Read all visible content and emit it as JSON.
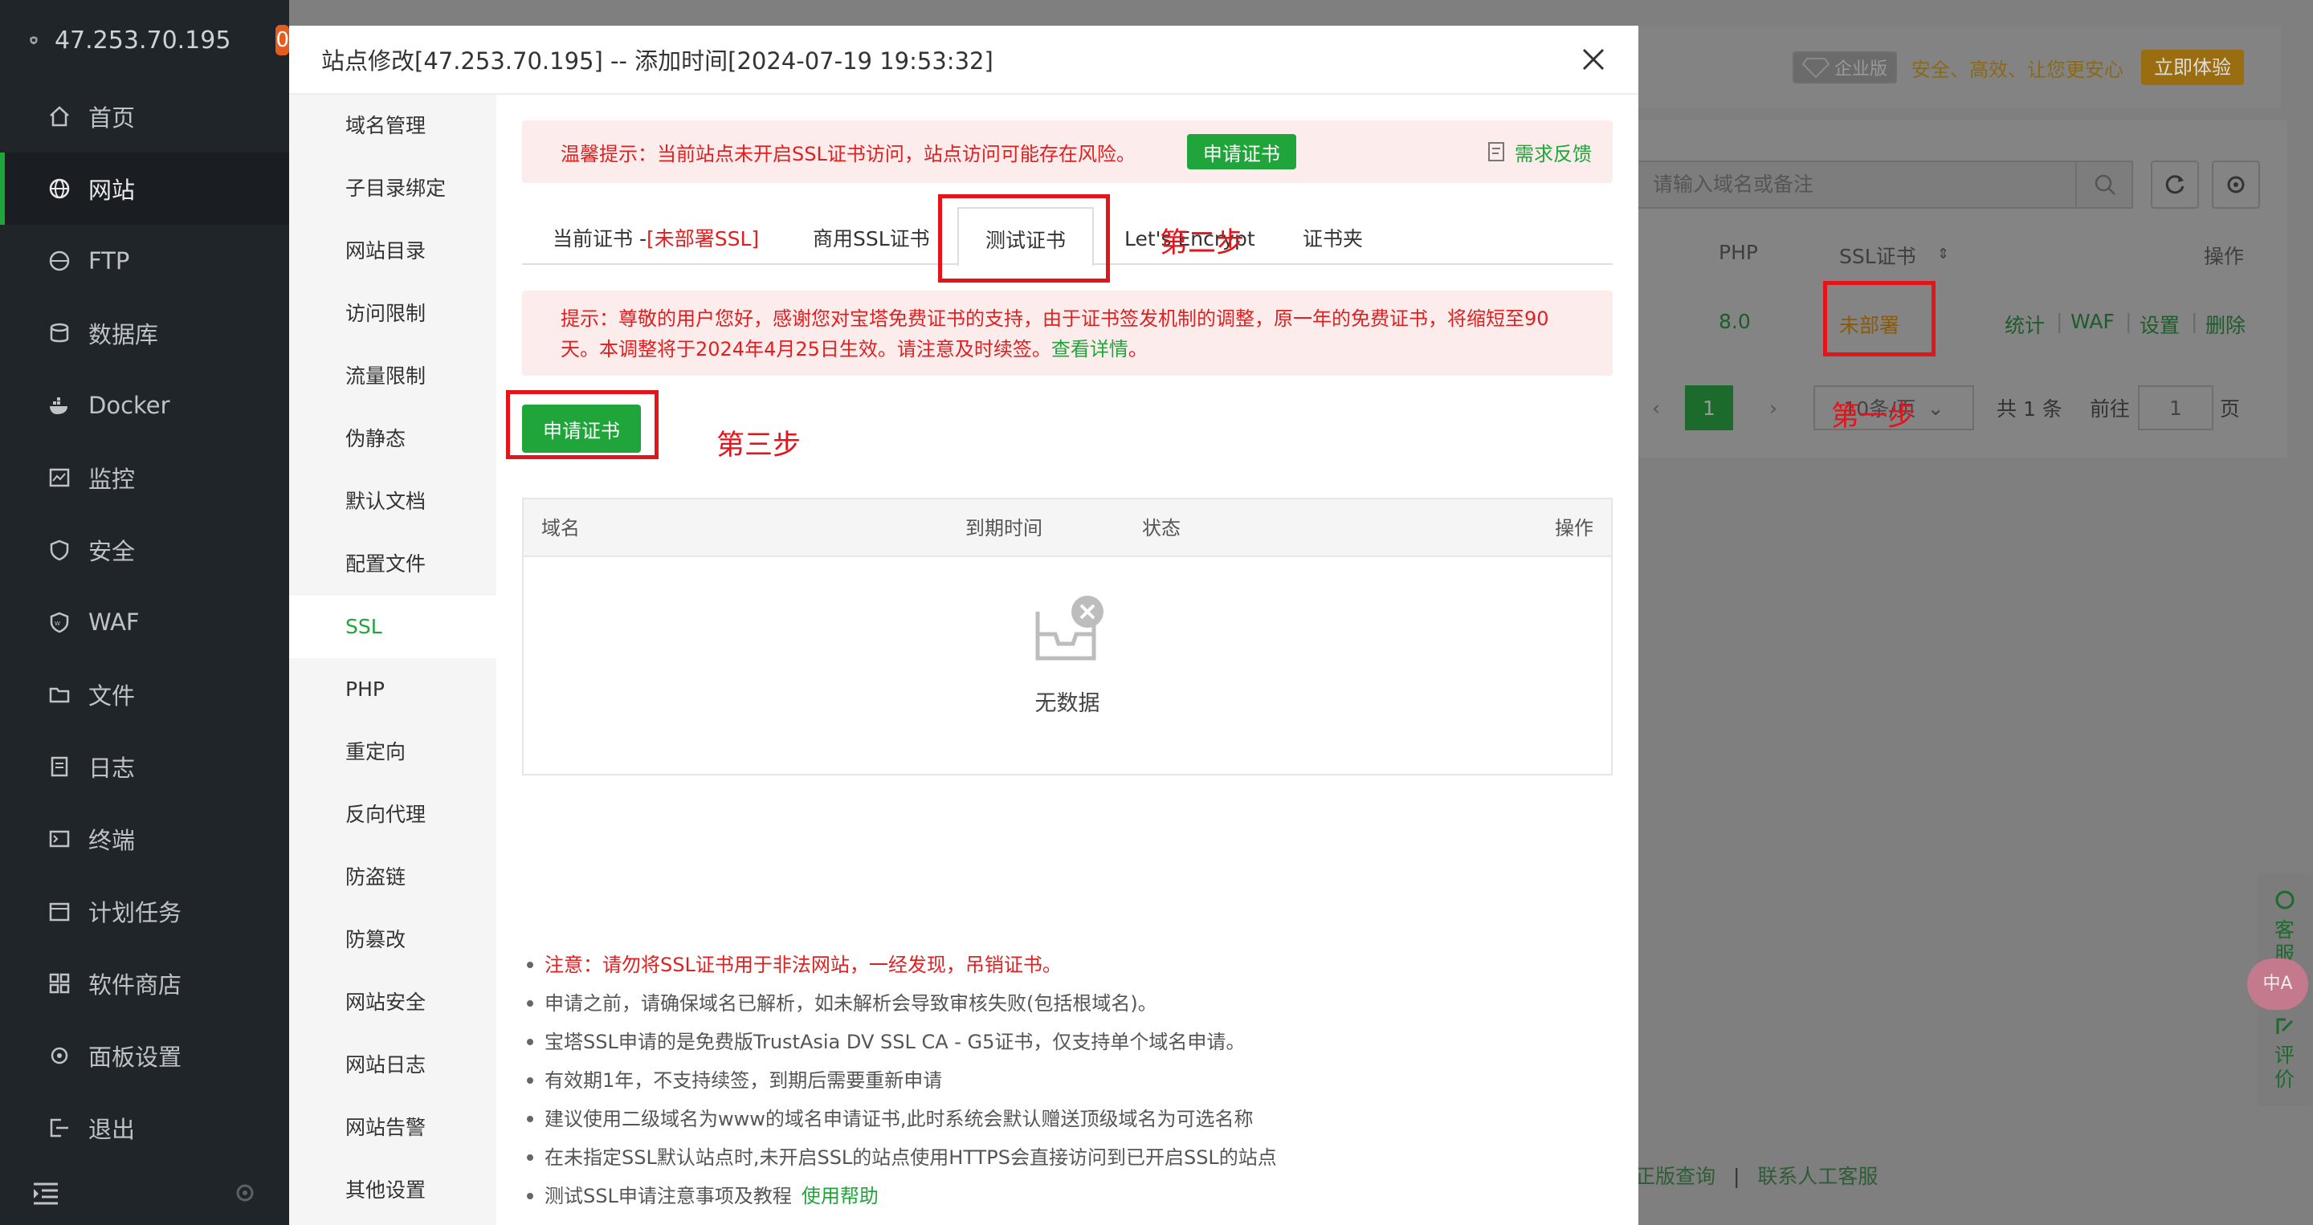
{
  "sidebar": {
    "ip": "47.253.70.195",
    "badge": "0",
    "items": [
      {
        "label": "首页",
        "icon": "home-icon"
      },
      {
        "label": "网站",
        "icon": "globe-icon"
      },
      {
        "label": "FTP",
        "icon": "ftp-icon"
      },
      {
        "label": "数据库",
        "icon": "database-icon"
      },
      {
        "label": "Docker",
        "icon": "docker-icon"
      },
      {
        "label": "监控",
        "icon": "monitor-icon"
      },
      {
        "label": "安全",
        "icon": "shield-icon"
      },
      {
        "label": "WAF",
        "icon": "waf-icon"
      },
      {
        "label": "文件",
        "icon": "folder-icon"
      },
      {
        "label": "日志",
        "icon": "log-icon"
      },
      {
        "label": "终端",
        "icon": "terminal-icon"
      },
      {
        "label": "计划任务",
        "icon": "calendar-icon"
      },
      {
        "label": "软件商店",
        "icon": "apps-icon"
      },
      {
        "label": "面板设置",
        "icon": "gear-icon"
      },
      {
        "label": "退出",
        "icon": "logout-icon"
      }
    ]
  },
  "background": {
    "enterprise": "企业版",
    "slogan": "安全、高效、让您更安心",
    "try_button": "立即体验",
    "search_placeholder": "请输入域名或备注",
    "columns": {
      "php": "PHP",
      "ssl": "SSL证书",
      "ops": "操作"
    },
    "row": {
      "php": "8.0",
      "ssl": "未部署",
      "actions": [
        "统计",
        "WAF",
        "设置",
        "删除"
      ]
    },
    "pagination": {
      "current": "1",
      "page_size": "10条/页",
      "total": "共 1 条",
      "goto_label": "前往",
      "goto_value": "1",
      "page_unit": "页"
    },
    "bottom_links": [
      "正版查询",
      "联系人工客服"
    ],
    "float": {
      "service": "客服",
      "review": "评价"
    }
  },
  "modal": {
    "title": "站点修改[47.253.70.195] -- 添加时间[2024-07-19 19:53:32]",
    "menu": [
      "域名管理",
      "子目录绑定",
      "网站目录",
      "访问限制",
      "流量限制",
      "伪静态",
      "默认文档",
      "配置文件",
      "SSL",
      "PHP",
      "重定向",
      "反向代理",
      "防盗链",
      "防篡改",
      "网站安全",
      "网站日志",
      "网站告警",
      "其他设置"
    ],
    "warning": {
      "text": "温馨提示：当前站点未开启SSL证书访问，站点访问可能存在风险。",
      "button": "申请证书",
      "feedback": "需求反馈"
    },
    "tabs": {
      "current_prefix": "当前证书 -",
      "current_status": "[未部署SSL]",
      "commercial": "商用SSL证书",
      "test": "测试证书",
      "letsencrypt": "Let's Encrypt",
      "folder": "证书夹"
    },
    "notice": {
      "line1": "提示：尊敬的用户您好，感谢您对宝塔免费证书的支持，由于证书签发机制的调整，原一年的免费证书，将缩短至90",
      "line2": "天。本调整将于2024年4月25日生效。请注意及时续签。",
      "link": "查看详情",
      "end": "。"
    },
    "apply_button": "申请证书",
    "table": {
      "headers": {
        "domain": "域名",
        "expire": "到期时间",
        "status": "状态",
        "ops": "操作"
      },
      "empty": "无数据"
    },
    "tips": [
      "注意：请勿将SSL证书用于非法网站，一经发现，吊销证书。",
      "申请之前，请确保域名已解析，如未解析会导致审核失败(包括根域名)。",
      "宝塔SSL申请的是免费版TrustAsia DV SSL CA - G5证书，仅支持单个域名申请。",
      "有效期1年，不支持续签，到期后需要重新申请",
      "建议使用二级域名为www的域名申请证书,此时系统会默认赠送顶级域名为可选名称",
      "在未指定SSL默认站点时,未开启SSL的站点使用HTTPS会直接访问到已开启SSL的站点",
      "测试SSL申请注意事项及教程"
    ],
    "tips_link": "使用帮助"
  },
  "annotations": {
    "step1": "第一步",
    "step2": "第二步",
    "step3": "第三步"
  },
  "colors": {
    "accent": "#20a53a",
    "danger": "#e02020",
    "annotation": "#e4141b",
    "sidebar": "#20252a"
  }
}
